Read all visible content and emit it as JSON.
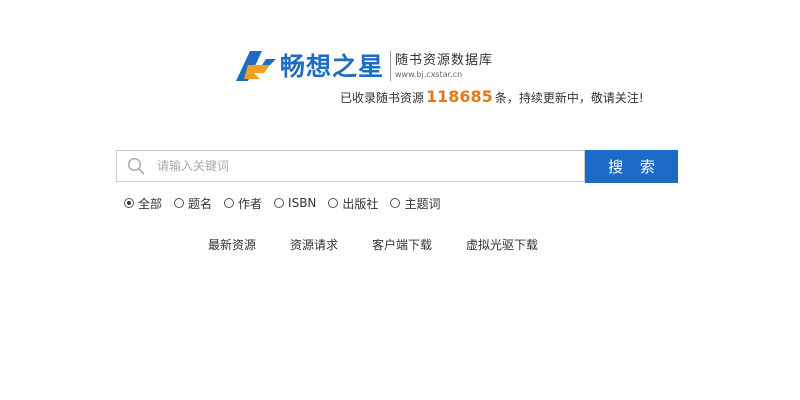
{
  "logo": {
    "name": "畅想之星",
    "subtitle": "随书资源数据库",
    "url": "www.bj.cxstar.cn",
    "colors": {
      "blue": "#1f6dc0",
      "orange": "#f0a020"
    }
  },
  "tagline": {
    "prefix": "已收录随书资源",
    "count": "118685",
    "suffix": "条，持续更新中，敬请关注!",
    "count_color": "#e07a1a"
  },
  "search": {
    "placeholder": "请输入关键词",
    "button_label": "搜 索",
    "button_color": "#1c6bc7",
    "icon": "search-icon"
  },
  "filters": {
    "options": [
      {
        "label": "全部",
        "checked": true
      },
      {
        "label": "题名",
        "checked": false
      },
      {
        "label": "作者",
        "checked": false
      },
      {
        "label": "ISBN",
        "checked": false
      },
      {
        "label": "出版社",
        "checked": false
      },
      {
        "label": "主题词",
        "checked": false
      }
    ]
  },
  "links": {
    "items": [
      "最新资源",
      "资源请求",
      "客户端下载",
      "虚拟光驱下载"
    ]
  }
}
